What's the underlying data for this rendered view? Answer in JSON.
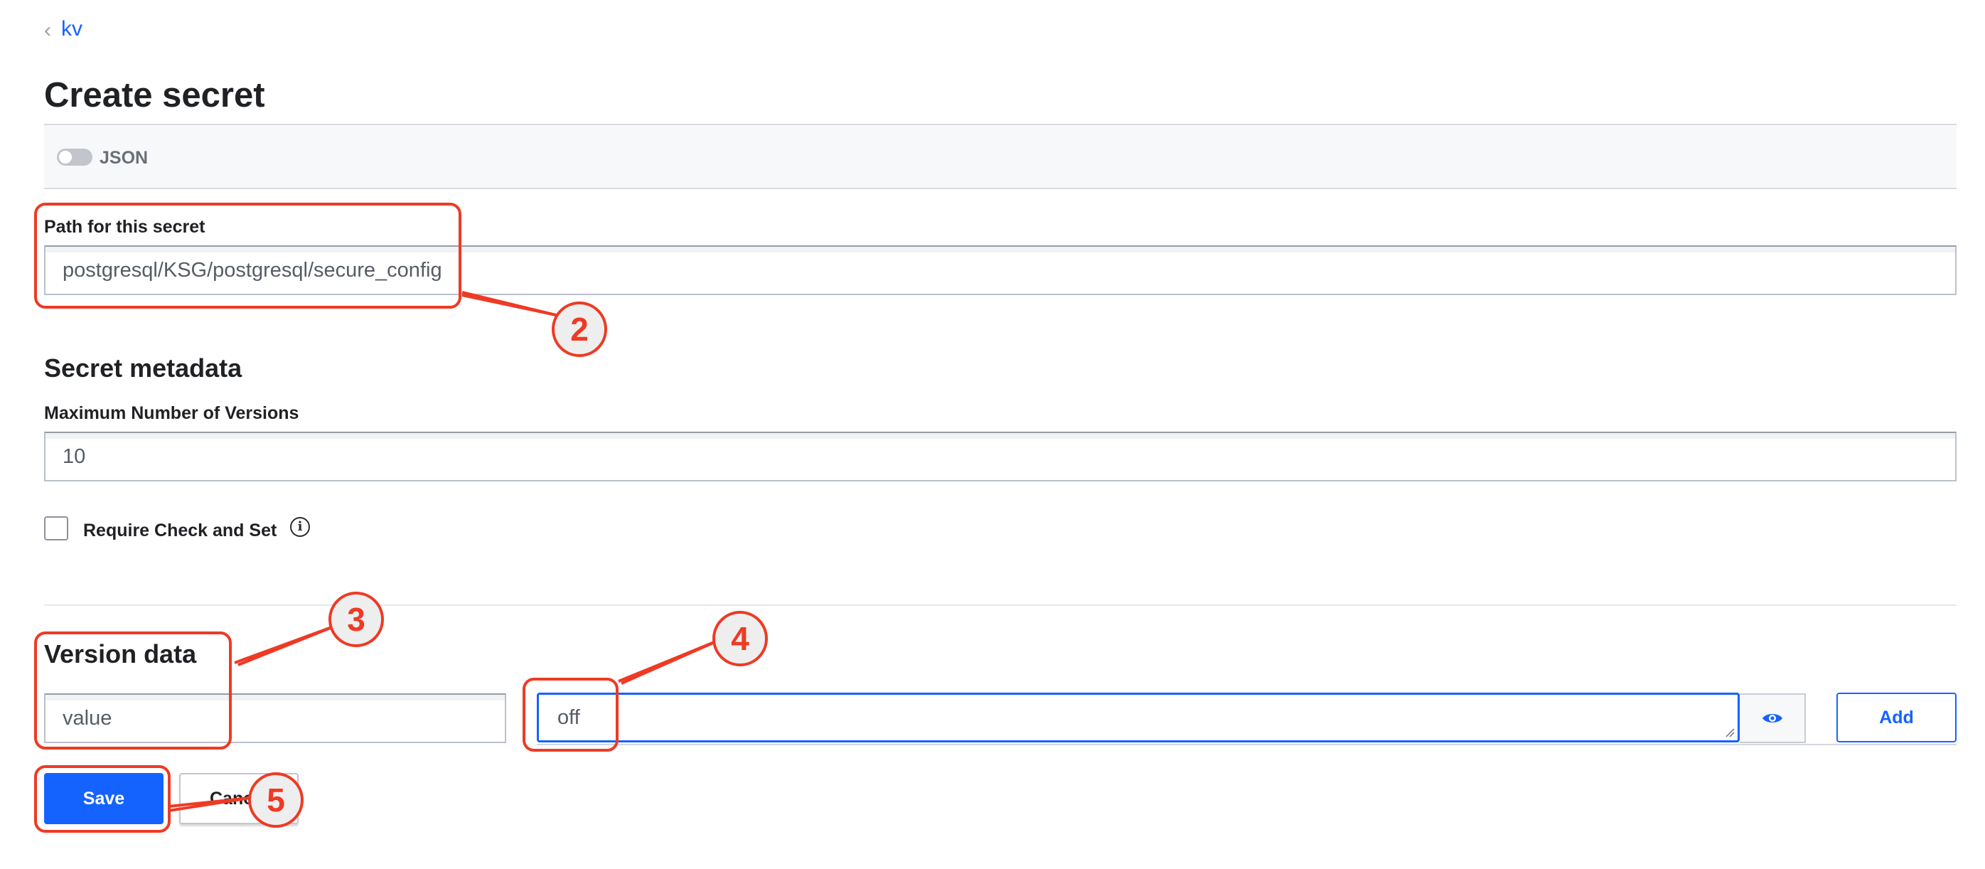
{
  "breadcrumb": {
    "chevron": "‹",
    "link": "kv"
  },
  "page_title": "Create secret",
  "toolbar": {
    "json_label": "JSON",
    "json_enabled": false
  },
  "path_field": {
    "label": "Path for this secret",
    "value": "postgresql/KSG/postgresql/secure_config"
  },
  "metadata": {
    "title": "Secret metadata",
    "max_versions_label": "Maximum Number of Versions",
    "max_versions_value": "10",
    "cas_label": "Require Check and Set",
    "cas_checked": false,
    "info_icon": "i"
  },
  "version_data": {
    "title": "Version data",
    "key_value": "value",
    "secret_value": "off",
    "add_label": "Add"
  },
  "actions": {
    "save_label": "Save",
    "cancel_label": "Cancel"
  },
  "annotations": {
    "callout_2": "2",
    "callout_3": "3",
    "callout_4": "4",
    "callout_5": "5"
  },
  "colors": {
    "accent": "#1563ff",
    "annotation": "#ee3a24",
    "text": "#1f2124"
  }
}
